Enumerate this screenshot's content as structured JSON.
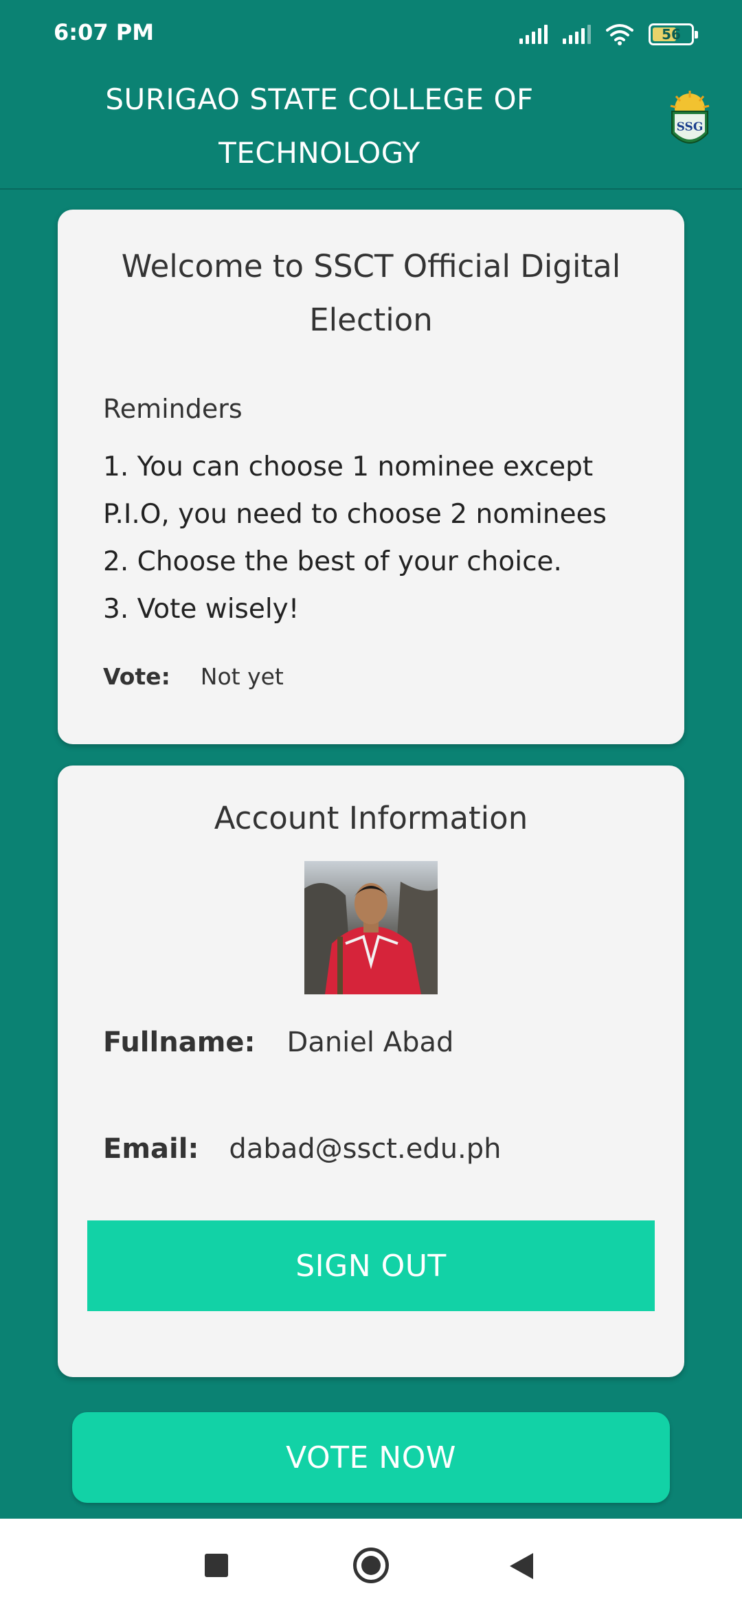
{
  "status_bar": {
    "time": "6:07 PM",
    "battery_level": "56",
    "icons": [
      "signal-icon",
      "signal-icon",
      "wifi-icon",
      "battery-icon"
    ]
  },
  "header": {
    "title": "SURIGAO STATE COLLEGE OF TECHNOLOGY",
    "logo_text": "SSG",
    "logo_icon": "ssg-logo-icon"
  },
  "welcome": {
    "title": "Welcome to SSCT Official Digital Election",
    "reminders_heading": "Reminders",
    "reminders": [
      "1. You can choose 1 nominee except P.I.O, you need to choose 2 nominees",
      "2. Choose the best of your choice.",
      "3. Vote wisely!"
    ],
    "vote_label": "Vote:",
    "vote_status": "Not yet"
  },
  "account": {
    "title": "Account Information",
    "fullname_label": "Fullname:",
    "fullname": "Daniel Abad",
    "email_label": "Email:",
    "email": "dabad@ssct.edu.ph",
    "signout_label": "SIGN OUT"
  },
  "vote_button_label": "VOTE NOW",
  "colors": {
    "primary": "#0b8273",
    "accent": "#12d2a6",
    "card": "#f4f4f4"
  }
}
